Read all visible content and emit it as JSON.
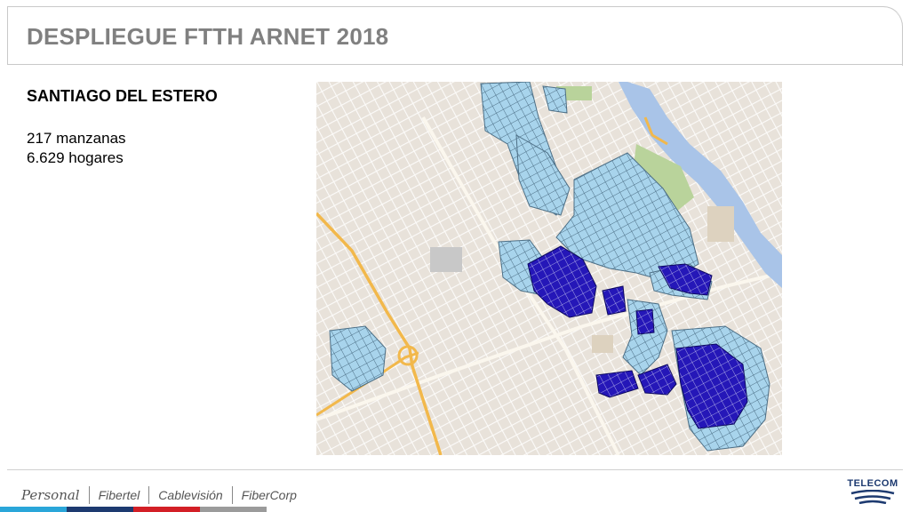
{
  "header": {
    "title": "DESPLIEGUE FTTH ARNET 2018"
  },
  "info": {
    "city": "SANTIAGO DEL ESTERO",
    "blocks": "217 manzanas",
    "homes": "6.629 hogares"
  },
  "map": {
    "colors": {
      "land": "#e8e2da",
      "street": "#ffffff",
      "highway": "#f2b84b",
      "river": "#a9c4e8",
      "park": "#b9d39b",
      "planned": "#a8d4ec",
      "deployed": "#2517b8"
    }
  },
  "footer": {
    "brands": [
      "Personal",
      "Fibertel",
      "Cablevisión",
      "FiberCorp"
    ],
    "bar_colors": [
      "#2aa6d9",
      "#1d3a70",
      "#d31f26",
      "#9b9b9b"
    ],
    "company": "TELECOM"
  }
}
